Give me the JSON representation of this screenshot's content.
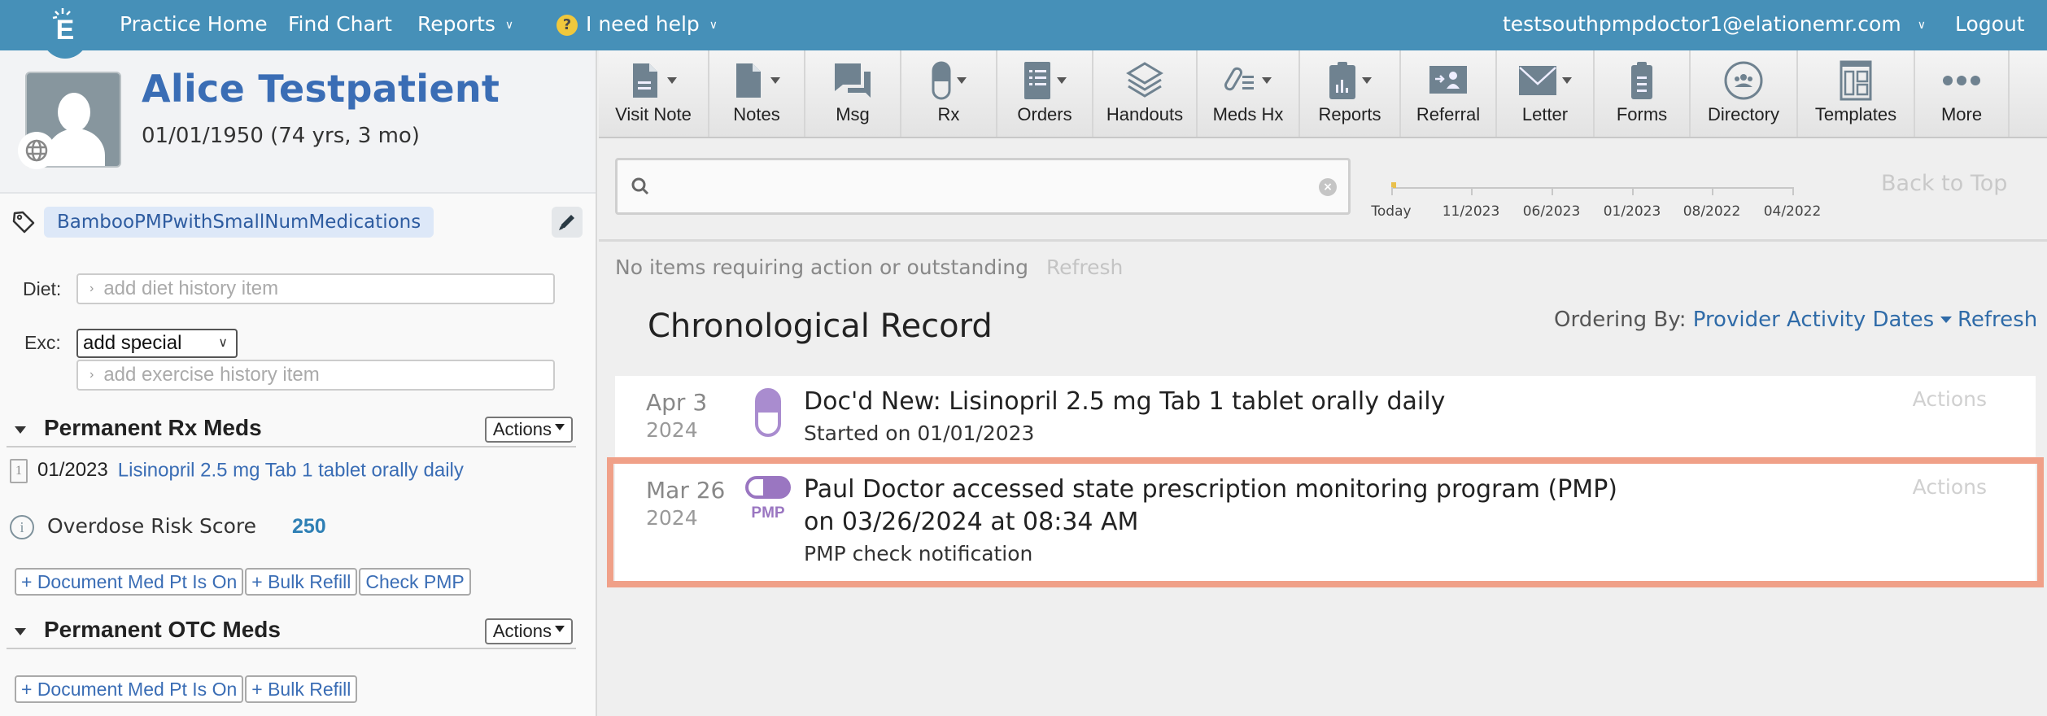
{
  "topbar": {
    "logo_letter": "E",
    "nav": {
      "practice_home": "Practice Home",
      "find_chart": "Find Chart",
      "reports": "Reports",
      "help": "I need help"
    },
    "help_glyph": "?",
    "user_email": "testsouthpmpdoctor1@elationemr.com",
    "logout": "Logout",
    "colors": {
      "bar": "#4690b8",
      "help_badge": "#f0c83c"
    }
  },
  "patient": {
    "name": "Alice Testpatient",
    "dob": "01/01/1950 (74 yrs, 3 mo)",
    "tag": "BambooPMPwithSmallNumMedications"
  },
  "history": {
    "diet_label": "Diet:",
    "diet_placeholder": "add diet history item",
    "exercise_label": "Exc:",
    "exercise_select": "add special",
    "exercise_placeholder": "add exercise history item"
  },
  "rx_meds": {
    "title": "Permanent Rx Meds",
    "actions": "Actions",
    "items": [
      {
        "count": "1",
        "date": "01/2023",
        "name": "Lisinopril 2.5 mg Tab 1 tablet orally daily"
      }
    ],
    "risk_label": "Overdose Risk Score",
    "risk_score": "250",
    "buttons": [
      "+ Document Med Pt Is On",
      "+ Bulk Refill",
      "Check PMP"
    ]
  },
  "otc_meds": {
    "title": "Permanent OTC Meds",
    "actions": "Actions",
    "buttons": [
      "+ Document Med Pt Is On",
      "+ Bulk Refill"
    ]
  },
  "toolbar": {
    "items": [
      {
        "label": "Visit Note",
        "icon": "document-icon",
        "dropdown": true
      },
      {
        "label": "Notes",
        "icon": "page-icon",
        "dropdown": true
      },
      {
        "label": "Msg",
        "icon": "chat-icon",
        "dropdown": false
      },
      {
        "label": "Rx",
        "icon": "pill-icon",
        "dropdown": true
      },
      {
        "label": "Orders",
        "icon": "list-icon",
        "dropdown": true
      },
      {
        "label": "Handouts",
        "icon": "layers-icon",
        "dropdown": false
      },
      {
        "label": "Meds Hx",
        "icon": "meds-history-icon",
        "dropdown": true
      },
      {
        "label": "Reports",
        "icon": "clipboard-chart-icon",
        "dropdown": true
      },
      {
        "label": "Referral",
        "icon": "referral-icon",
        "dropdown": false
      },
      {
        "label": "Letter",
        "icon": "envelope-icon",
        "dropdown": true
      },
      {
        "label": "Forms",
        "icon": "clipboard-icon",
        "dropdown": false
      },
      {
        "label": "Directory",
        "icon": "people-circle-icon",
        "dropdown": false
      },
      {
        "label": "Templates",
        "icon": "template-icon",
        "dropdown": false
      },
      {
        "label": "More",
        "icon": "more-dots-icon",
        "dropdown": false
      }
    ]
  },
  "search": {
    "placeholder": "",
    "value": ""
  },
  "timeline": {
    "labels": [
      "Today",
      "11/2023",
      "06/2023",
      "01/2023",
      "08/2022",
      "04/2022"
    ],
    "back_to_top": "Back to Top"
  },
  "pending": {
    "text": "No items requiring action or outstanding",
    "refresh": "Refresh"
  },
  "chronological": {
    "title": "Chronological Record",
    "ordering_label": "Ordering By:",
    "ordering_value": "Provider Activity Dates",
    "refresh": "Refresh",
    "entries": [
      {
        "date": "Apr 3",
        "year": "2024",
        "icon": "pill-icon",
        "title": "Doc'd New: Lisinopril 2.5 mg Tab 1 tablet orally daily",
        "subtitle": "Started on 01/01/2023",
        "actions": "Actions"
      },
      {
        "date": "Mar 26",
        "year": "2024",
        "icon": "pmp-pill-icon",
        "icon_label": "PMP",
        "title": "Paul Doctor accessed state prescription monitoring program (PMP) on 03/26/2024 at 08:34 AM",
        "subtitle": "PMP check notification",
        "actions": "Actions",
        "highlighted": true
      }
    ],
    "colors": {
      "pill": "#a98ccf",
      "highlight_border": "#f0a088"
    }
  }
}
